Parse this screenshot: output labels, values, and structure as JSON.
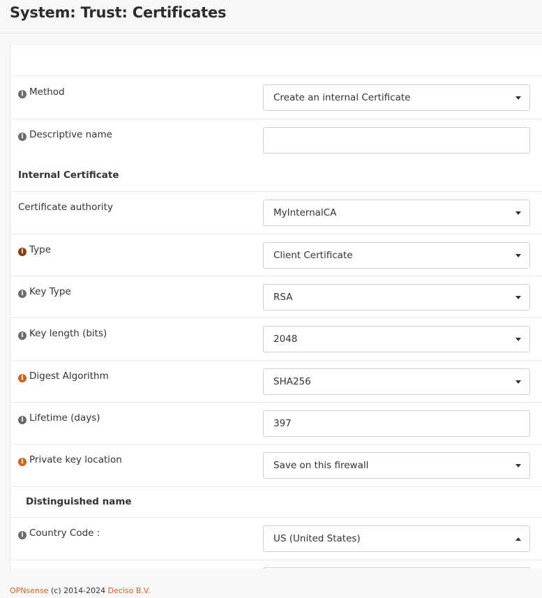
{
  "page": {
    "title": "System: Trust: Certificates"
  },
  "form": {
    "method": {
      "label": "Method",
      "value": "Create an internal Certificate"
    },
    "descriptive_name": {
      "label": "Descriptive name",
      "value": ""
    },
    "internal_section": "Internal Certificate",
    "certificate_authority": {
      "label": "Certificate authority",
      "value": "MyInternalCA"
    },
    "type": {
      "label": "Type",
      "value": "Client Certificate"
    },
    "key_type": {
      "label": "Key Type",
      "value": "RSA"
    },
    "key_length": {
      "label": "Key length (bits)",
      "value": "2048"
    },
    "digest_algorithm": {
      "label": "Digest Algorithm",
      "value": "SHA256"
    },
    "lifetime": {
      "label": "Lifetime (days)",
      "value": "397"
    },
    "private_key_location": {
      "label": "Private key location",
      "value": "Save on this firewall"
    },
    "dn_section": "Distinguished name",
    "country_code": {
      "label": "Country Code :",
      "value": "US (United States)"
    }
  },
  "footer": {
    "brand": "OPNsense",
    "copyright": " (c) 2014-2024 ",
    "company": "Deciso B.V."
  },
  "colors": {
    "accent": "#d4621f",
    "info_gray": "#6b6b6b",
    "info_brown": "#8a3d0b"
  },
  "icons": {
    "info": "info-circle-icon",
    "dropdown": "caret-down-icon",
    "dropdown_open": "caret-up-icon"
  }
}
